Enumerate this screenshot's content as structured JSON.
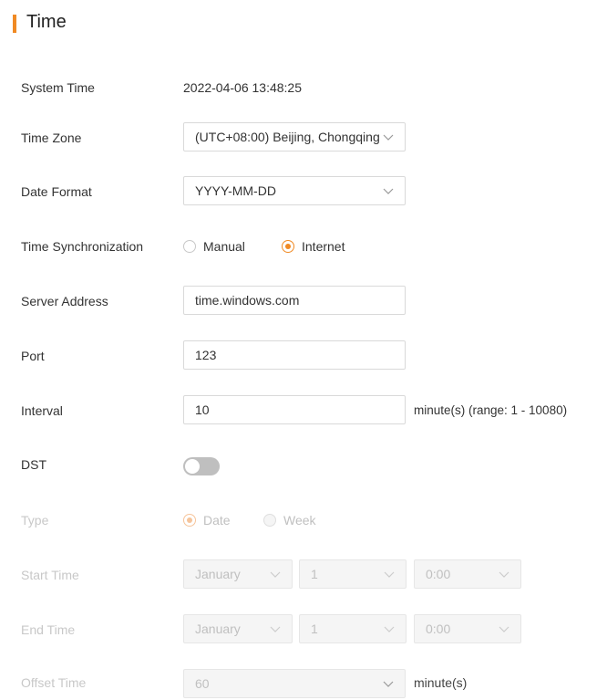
{
  "section": {
    "title": "Time",
    "accent_color": "#f08a24"
  },
  "system_time": {
    "label": "System Time",
    "value": "2022-04-06 13:48:25"
  },
  "time_zone": {
    "label": "Time Zone",
    "value": "(UTC+08:00) Beijing, Chongqing"
  },
  "date_format": {
    "label": "Date Format",
    "value": "YYYY-MM-DD"
  },
  "time_sync": {
    "label": "Time Synchronization",
    "options": [
      "Manual",
      "Internet"
    ],
    "selected": "Internet"
  },
  "server_address": {
    "label": "Server Address",
    "value": "time.windows.com"
  },
  "port": {
    "label": "Port",
    "value": "123"
  },
  "interval": {
    "label": "Interval",
    "value": "10",
    "suffix": "minute(s) (range: 1 - 10080)"
  },
  "dst": {
    "label": "DST",
    "enabled": false
  },
  "type": {
    "label": "Type",
    "options": [
      "Date",
      "Week"
    ],
    "selected": "Date"
  },
  "start_time": {
    "label": "Start Time",
    "month": "January",
    "day": "1",
    "time": "0:00"
  },
  "end_time": {
    "label": "End Time",
    "month": "January",
    "day": "1",
    "time": "0:00"
  },
  "offset_time": {
    "label": "Offset Time",
    "value": "60",
    "suffix": "minute(s)"
  }
}
